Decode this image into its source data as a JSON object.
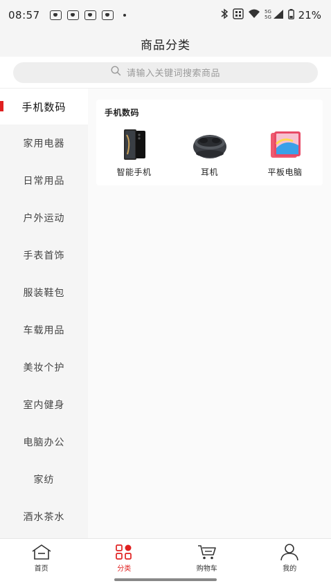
{
  "status_bar": {
    "time": "08:57",
    "battery": "21%",
    "notification_icons": [
      "notification-icon",
      "notification-icon",
      "notification-icon",
      "notification-icon"
    ],
    "right_icons": [
      "bluetooth-icon",
      "nfc-icon",
      "wifi-icon",
      "signal-5g-icon",
      "battery-icon"
    ]
  },
  "header": {
    "title": "商品分类"
  },
  "search": {
    "placeholder": "请输入关键词搜索商品"
  },
  "sidebar": {
    "items": [
      {
        "label": "手机数码",
        "active": true
      },
      {
        "label": "家用电器"
      },
      {
        "label": "日常用品"
      },
      {
        "label": "户外运动"
      },
      {
        "label": "手表首饰"
      },
      {
        "label": "服装鞋包"
      },
      {
        "label": "车载用品"
      },
      {
        "label": "美妆个护"
      },
      {
        "label": "室内健身"
      },
      {
        "label": "电脑办公"
      },
      {
        "label": "家纺"
      },
      {
        "label": "酒水茶水"
      }
    ]
  },
  "content": {
    "section_title": "手机数码",
    "products": [
      {
        "name": "智能手机",
        "icon": "smartphone-image"
      },
      {
        "name": "耳机",
        "icon": "earbuds-image"
      },
      {
        "name": "平板电脑",
        "icon": "tablet-image"
      }
    ]
  },
  "tabbar": {
    "tabs": [
      {
        "label": "首页",
        "icon": "home-icon"
      },
      {
        "label": "分类",
        "icon": "category-icon",
        "active": true
      },
      {
        "label": "购物车",
        "icon": "cart-icon"
      },
      {
        "label": "我的",
        "icon": "user-icon"
      }
    ],
    "accent": "#e02020"
  }
}
